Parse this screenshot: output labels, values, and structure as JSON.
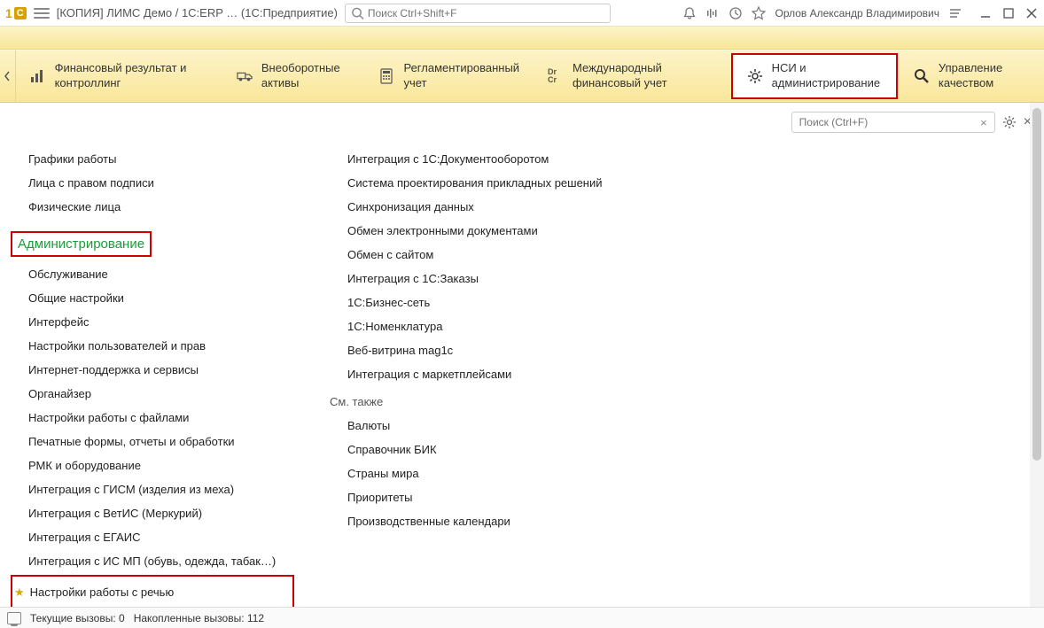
{
  "titlebar": {
    "app_title": "[КОПИЯ] ЛИМС Демо / 1C:ERP …   (1С:Предприятие)",
    "search_placeholder": "Поиск Ctrl+Shift+F",
    "username": "Орлов Александр Владимирович"
  },
  "topnav": {
    "items": [
      {
        "label": "Финансовый результат и контроллинг",
        "icon": "chart-bar-icon"
      },
      {
        "label": "Внеоборотные активы",
        "icon": "truck-icon"
      },
      {
        "label": "Регламентированный учет",
        "icon": "calculator-icon"
      },
      {
        "label": "Международный финансовый учет",
        "icon": "dr-cr-icon"
      },
      {
        "label": "НСИ и администрирование",
        "icon": "gear-icon",
        "highlighted": true
      },
      {
        "label": "Управление качеством",
        "icon": "search-icon"
      }
    ]
  },
  "content": {
    "search_placeholder": "Поиск (Ctrl+F)",
    "col1_top": [
      "Графики работы",
      "Лица с правом подписи",
      "Физические лица"
    ],
    "section_title": "Администрирование",
    "col1_admin": [
      "Обслуживание",
      "Общие настройки",
      "Интерфейс",
      "Настройки пользователей и прав",
      "Интернет-поддержка и сервисы",
      "Органайзер",
      "Настройки работы с файлами",
      "Печатные формы, отчеты и обработки",
      "РМК и оборудование",
      "Интеграция с ГИСМ (изделия из меха)",
      "Интеграция с ВетИС (Меркурий)",
      "Интеграция с ЕГАИС",
      "Интеграция с ИС МП (обувь, одежда, табак…)"
    ],
    "starred_item": "Настройки работы с речью",
    "col2_integration": [
      "Интеграция с 1С:Документооборотом",
      "Система проектирования прикладных решений",
      "Синхронизация данных",
      "Обмен электронными документами",
      "Обмен с сайтом",
      "Интеграция с 1С:Заказы",
      "1С:Бизнес-сеть",
      "1С:Номенклатура",
      "Веб-витрина mag1c",
      "Интеграция с маркетплейсами"
    ],
    "see_also_hdr": "См. также",
    "col2_seealso": [
      "Валюты",
      "Справочник БИК",
      "Страны мира",
      "Приоритеты",
      "Производственные календари"
    ]
  },
  "statusbar": {
    "current_calls_label": "Текущие вызовы:",
    "current_calls_value": "0",
    "accumulated_calls_label": "Накопленные вызовы:",
    "accumulated_calls_value": "112"
  }
}
